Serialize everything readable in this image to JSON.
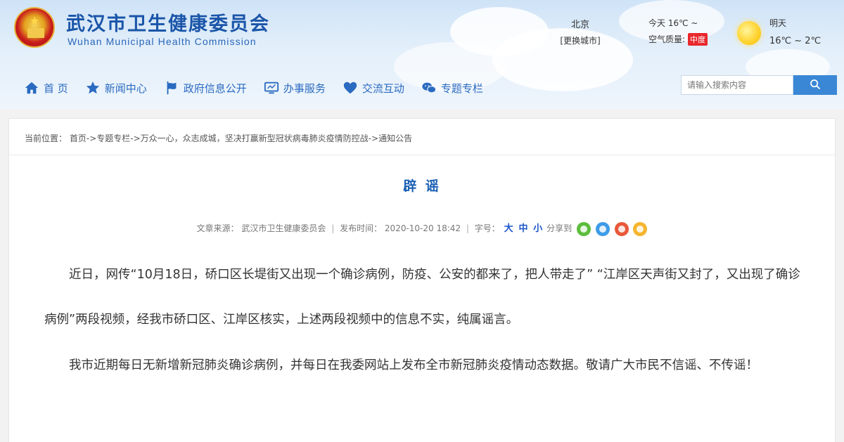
{
  "header": {
    "site_name_cn": "武汉市卫生健康委员会",
    "site_name_en": "Wuhan Municipal Health Commission",
    "city": "北京",
    "change_city": "[更换城市]",
    "today_label": "今天 16℃ ~",
    "air_quality_label": "空气质量:",
    "air_quality_badge": "中度",
    "tomorrow_label": "明天",
    "tomorrow_temp": "16℃ ~ 2℃"
  },
  "nav": {
    "items": [
      {
        "label": "首 页",
        "icon": "home-icon"
      },
      {
        "label": "新闻中心",
        "icon": "star-icon"
      },
      {
        "label": "政府信息公开",
        "icon": "flag-icon"
      },
      {
        "label": "办事服务",
        "icon": "monitor-icon"
      },
      {
        "label": "交流互动",
        "icon": "heart-icon"
      },
      {
        "label": "专题专栏",
        "icon": "wechat-icon"
      }
    ],
    "search_placeholder": "请输入搜索内容"
  },
  "breadcrumb": {
    "prefix": "当前位置：",
    "items": [
      "首页",
      "专题专栏",
      "万众一心，众志成城，坚决打赢新型冠状病毒肺炎疫情防控战",
      "通知公告"
    ],
    "separator": "->"
  },
  "article": {
    "title": "辟 谣",
    "source_label": "文章来源：",
    "source": "武汉市卫生健康委员会",
    "publish_label": "发布时间：",
    "publish_time": "2020-10-20 18:42",
    "font_size_label": "字号：",
    "font_large": "大",
    "font_medium": "中",
    "font_small": "小",
    "share_label": "分享到",
    "paragraphs": [
      "近日，网传“10月18日，硚口区长堤街又出现一个确诊病例，防疫、公安的都来了，把人带走了” “江岸区天声街又封了，又出现了确诊病例”两段视频，经我市硚口区、江岸区核实，上述两段视频中的信息不实，纯属谣言。",
      "我市近期每日无新增新冠肺炎确诊病例，并每日在我委网站上发布全市新冠肺炎疫情动态数据。敬请广大市民不信谣、不传谣！"
    ]
  },
  "colors": {
    "brand_blue": "#1a55a8",
    "nav_blue": "#2a6ac0",
    "search_button": "#3a87d6",
    "title_blue": "#1a5fb4",
    "badge_red": "#e8282d"
  }
}
